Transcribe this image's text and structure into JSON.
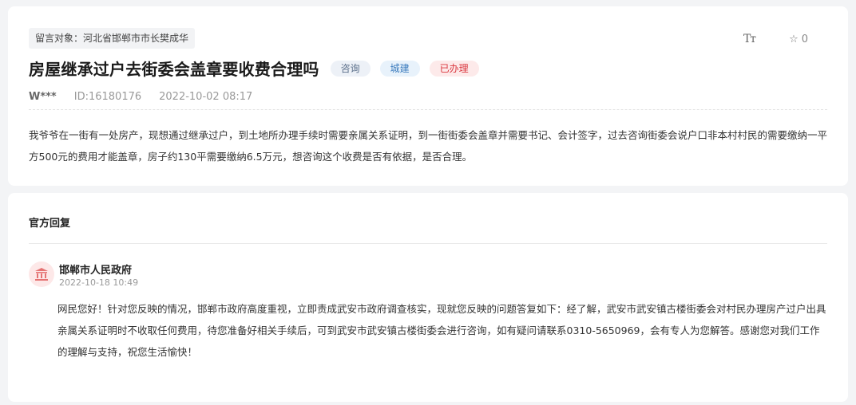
{
  "message": {
    "target_label": "留言对象：河北省邯郸市市长樊成华",
    "tools": {
      "font_size_icon": "Tт",
      "favorite_icon": "☆",
      "favorite_count": "0"
    },
    "title": "房屋继承过户去街委会盖章要收费合理吗",
    "badges": [
      "咨询",
      "城建",
      "已办理"
    ],
    "author": "W***",
    "id_text": "ID:16180176",
    "datetime": "2022-10-02 08:17",
    "content": "我爷爷在一街有一处房产，现想通过继承过户，到土地所办理手续时需要亲属关系证明，到一街街委会盖章并需要书记、会计签字，过去咨询街委会说户口非本村村民的需要缴纳一平方500元的费用才能盖章，房子约130平需要缴纳6.5万元，想咨询这个收费是否有依据，是否合理。"
  },
  "reply_section": {
    "title": "官方回复",
    "org_name": "邯郸市人民政府",
    "org_icon": "government-building-icon",
    "date": "2022-10-18 10:49",
    "text": "网民您好！针对您反映的情况，邯郸市政府高度重视，立即责成武安市政府调查核实，现就您反映的问题答复如下：经了解，武安市武安镇古楼街委会对村民办理房产过户出具亲属关系证明时不收取任何费用，待您准备好相关手续后，可到武安市武安镇古楼街委会进行咨询，如有疑问请联系0310-5650969，会有专人为您解答。感谢您对我们工作的理解与支持，祝您生活愉快！"
  },
  "colors": {
    "badge_consult": "#5b6f8a",
    "badge_city": "#3b7bbd",
    "badge_done": "#d9363e",
    "org_icon": "#e57373"
  }
}
